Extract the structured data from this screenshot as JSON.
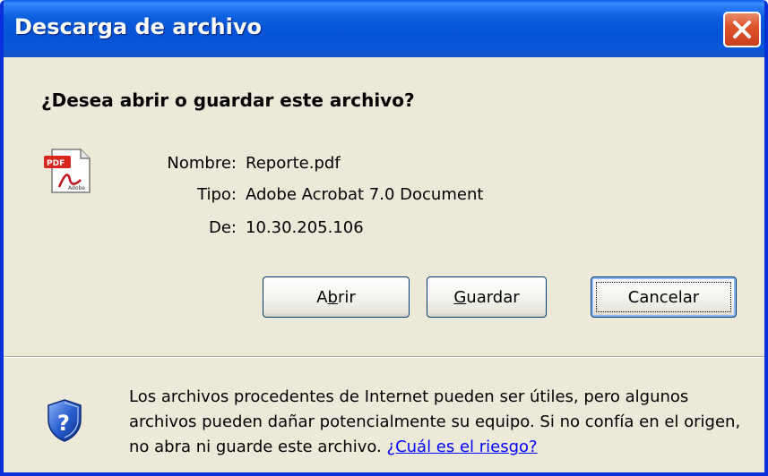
{
  "window": {
    "title": "Descarga de archivo"
  },
  "dialog": {
    "question": "¿Desea abrir o guardar este archivo?",
    "file_icon": "pdf-icon",
    "info": [
      {
        "label": "Nombre:",
        "value": "Reporte.pdf"
      },
      {
        "label": "Tipo:",
        "value": "Adobe Acrobat 7.0 Document"
      },
      {
        "label": "De:",
        "value": "10.30.205.106"
      }
    ],
    "buttons": {
      "open_label_pre": "A",
      "open_label_accel": "b",
      "open_label_post": "rir",
      "save_label_accel": "G",
      "save_label_post": "uardar",
      "cancel_label": "Cancelar"
    },
    "warning": {
      "icon": "shield-question-icon",
      "text": "Los archivos procedentes de Internet pueden ser útiles, pero algunos archivos pueden dañar potencialmente su equipo. Si no confía en el origen, no abra ni guarde este archivo.",
      "link_text": "¿Cuál es el riesgo?"
    }
  },
  "colors": {
    "titlebar": "#0553d6",
    "window_bg": "#ece9d8",
    "close_button": "#e0552d",
    "link": "#0000ff"
  }
}
